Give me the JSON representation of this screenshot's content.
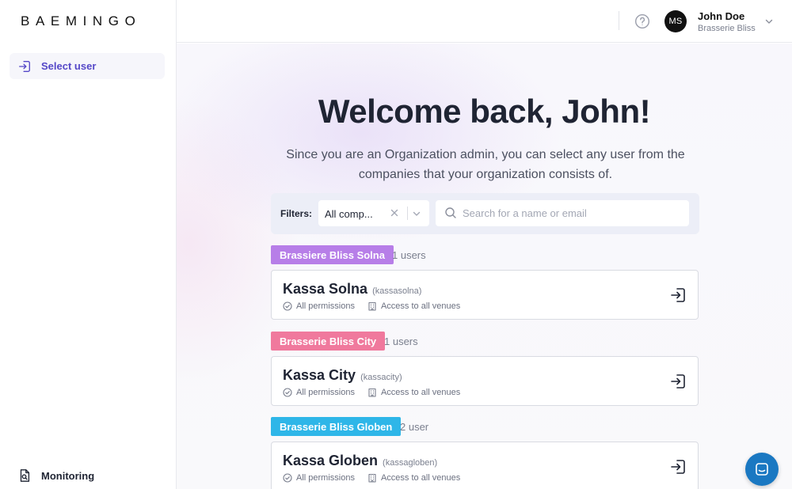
{
  "brand": {
    "logo_text": "BAEMINGO"
  },
  "sidebar": {
    "items": [
      {
        "label": "Select user",
        "icon": "login-icon",
        "active": true
      },
      {
        "label": "Monitoring",
        "icon": "document-search-icon",
        "active": false
      }
    ]
  },
  "header": {
    "help_icon": "help-circle-icon",
    "user": {
      "initials": "MS",
      "name": "John Doe",
      "organization": "Brasserie Bliss"
    }
  },
  "main": {
    "title": "Welcome back, John!",
    "subtitle": "Since you are an Organization admin, you can select any user from the companies that your organization consists of.",
    "filters": {
      "label": "Filters:",
      "company_select_value": "All comp...",
      "search_placeholder": "Search for a name or email",
      "search_value": ""
    },
    "groups": [
      {
        "company": "Brassiere Bliss Solna",
        "count_label": "1 users",
        "color": "#b77ee8",
        "users": [
          {
            "name": "Kassa Solna",
            "username": "(kassasolna)",
            "permissions": "All permissions",
            "access": "Access to all venues"
          }
        ]
      },
      {
        "company": "Brasserie Bliss City",
        "count_label": "1 users",
        "color": "#f0799d",
        "users": [
          {
            "name": "Kassa City",
            "username": "(kassacity)",
            "permissions": "All permissions",
            "access": "Access to all venues"
          }
        ]
      },
      {
        "company": "Brasserie Bliss Globen",
        "count_label": "2 user",
        "color": "#2eb6e8",
        "users": [
          {
            "name": "Kassa Globen",
            "username": "(kassagloben)",
            "permissions": "All permissions",
            "access": "Access to all venues"
          }
        ]
      }
    ]
  },
  "colors": {
    "accent": "#5548c8",
    "chat_button": "#1a78c2"
  }
}
